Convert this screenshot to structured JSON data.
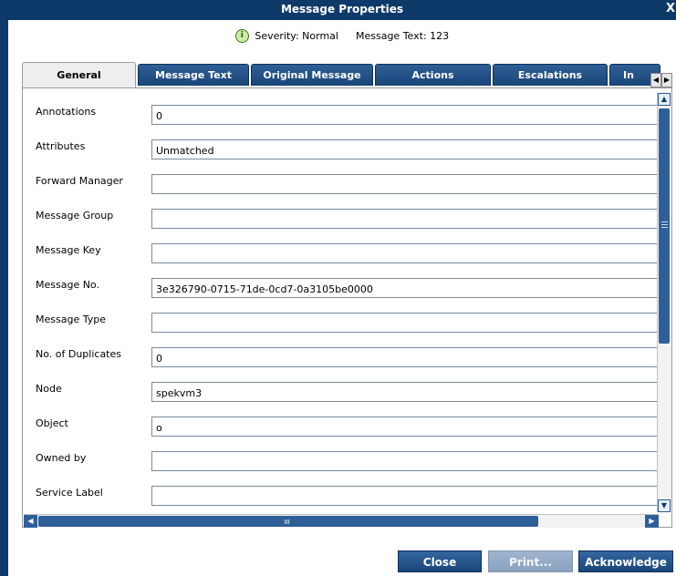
{
  "window": {
    "title": "Message Properties",
    "close_glyph": "X"
  },
  "info": {
    "severity": "Severity: Normal",
    "message_text": "Message Text: 123",
    "severity_icon": "info-circle-icon"
  },
  "tabs": [
    {
      "label": "General",
      "active": true
    },
    {
      "label": "Message Text",
      "active": false
    },
    {
      "label": "Original Message",
      "active": false
    },
    {
      "label": "Actions",
      "active": false
    },
    {
      "label": "Escalations",
      "active": false
    },
    {
      "label": "In",
      "active": false
    }
  ],
  "fields": [
    {
      "label": "Annotations",
      "value": "0"
    },
    {
      "label": "Attributes",
      "value": "Unmatched"
    },
    {
      "label": "Forward Manager",
      "value": ""
    },
    {
      "label": "Message Group",
      "value": ""
    },
    {
      "label": "Message Key",
      "value": ""
    },
    {
      "label": "Message No.",
      "value": "3e326790-0715-71de-0cd7-0a3105be0000"
    },
    {
      "label": "Message Type",
      "value": ""
    },
    {
      "label": "No. of Duplicates",
      "value": "0"
    },
    {
      "label": "Node",
      "value": "spekvm3"
    },
    {
      "label": "Object",
      "value": "o"
    },
    {
      "label": "Owned by",
      "value": ""
    },
    {
      "label": "Service Label",
      "value": ""
    }
  ],
  "buttons": {
    "close": {
      "label": "Close",
      "enabled": true
    },
    "print": {
      "label": "Print...",
      "enabled": false
    },
    "acknowledge": {
      "label": "Acknowledge",
      "enabled": true
    }
  },
  "colors": {
    "title_bar": "#0e3a6a",
    "tab_active": "#eeeeee",
    "tab_inactive": "#1a4679",
    "button": "#1a4679"
  }
}
